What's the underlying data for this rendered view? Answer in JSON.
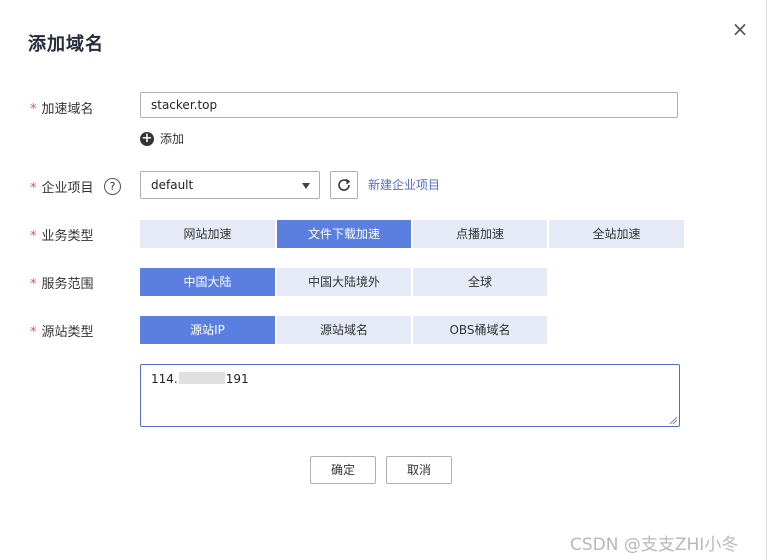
{
  "dialog": {
    "title": "添加域名",
    "close_glyph": "×",
    "required_mark": "*"
  },
  "fields": {
    "domain": {
      "label": "加速域名",
      "value": "stacker.top"
    },
    "add": {
      "icon": "plus-circle-icon",
      "label": "添加"
    },
    "project": {
      "label": "企业项目",
      "help_glyph": "?",
      "selected": "default",
      "refresh_icon": "refresh-icon",
      "create_link": "新建企业项目"
    },
    "business_type": {
      "label": "业务类型",
      "options": [
        "网站加速",
        "文件下载加速",
        "点播加速",
        "全站加速"
      ],
      "selected_index": 1
    },
    "service_scope": {
      "label": "服务范围",
      "options": [
        "中国大陆",
        "中国大陆境外",
        "全球"
      ],
      "selected_index": 0
    },
    "origin_type": {
      "label": "源站类型",
      "options": [
        "源站IP",
        "源站域名",
        "OBS桶域名"
      ],
      "selected_index": 0
    },
    "origin_ip": {
      "prefix": "114.",
      "suffix": "191"
    }
  },
  "buttons": {
    "confirm": "确定",
    "cancel": "取消"
  },
  "watermark": "CSDN @支支ZHI小冬",
  "colors": {
    "accent": "#5b7fe0",
    "segment_bg": "#e5ebf6",
    "link": "#526ecc",
    "required": "#e15050"
  }
}
